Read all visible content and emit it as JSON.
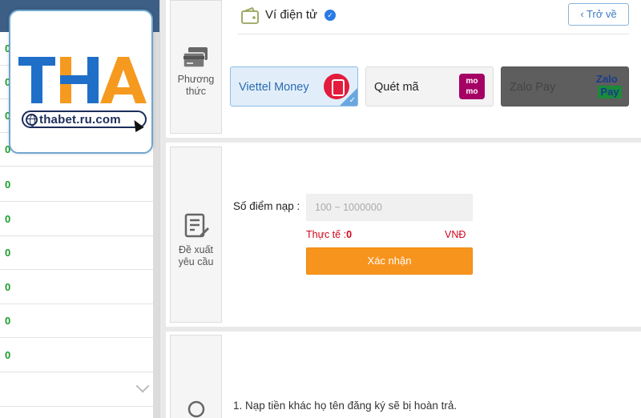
{
  "sidebar": {
    "rows": [
      {
        "value": "0"
      },
      {
        "value": "0"
      },
      {
        "value": "0"
      },
      {
        "value": "0"
      },
      {
        "value": "0"
      },
      {
        "value": "0"
      },
      {
        "value": "0"
      },
      {
        "value": "0"
      },
      {
        "value": "0"
      },
      {
        "value": "0"
      }
    ]
  },
  "logo": {
    "brand": "THA",
    "url": "thabet.ru.com",
    "colors": {
      "blue": "#1f6fc8",
      "orange": "#f59a1f",
      "navy": "#1c2d5a"
    }
  },
  "payment_method": {
    "section_label_1": "Phương",
    "section_label_2": "thức",
    "wallet_title": "Ví điện tử",
    "back_label": "Trở về",
    "methods": [
      {
        "label": "Viettel Money",
        "selected": true,
        "icon": "viettel-money-icon"
      },
      {
        "label": "Quét mã",
        "selected": false,
        "icon": "momo-icon",
        "icon_text_1": "mo",
        "icon_text_2": "mo"
      },
      {
        "label": "Zalo Pay",
        "selected": false,
        "icon": "zalopay-icon",
        "icon_text_1": "Zalo",
        "icon_text_2": "Pay"
      }
    ]
  },
  "request": {
    "section_label_1": "Đề xuất",
    "section_label_2": "yêu cầu",
    "points_label": "Số điểm nạp :",
    "points_placeholder": "100 ~ 1000000",
    "actual_label": "Thực tế :",
    "actual_value": "0",
    "currency": "VNĐ",
    "confirm_label": "Xác nhận"
  },
  "notes": {
    "items": [
      "1.  Nạp tiền khác họ tên đăng ký sẽ bị hoàn trả."
    ]
  },
  "colors": {
    "accent_orange": "#f7941d",
    "selected_blue": "#e1eefa",
    "error_red": "#d0021b",
    "value_green": "#1a9d2a"
  }
}
